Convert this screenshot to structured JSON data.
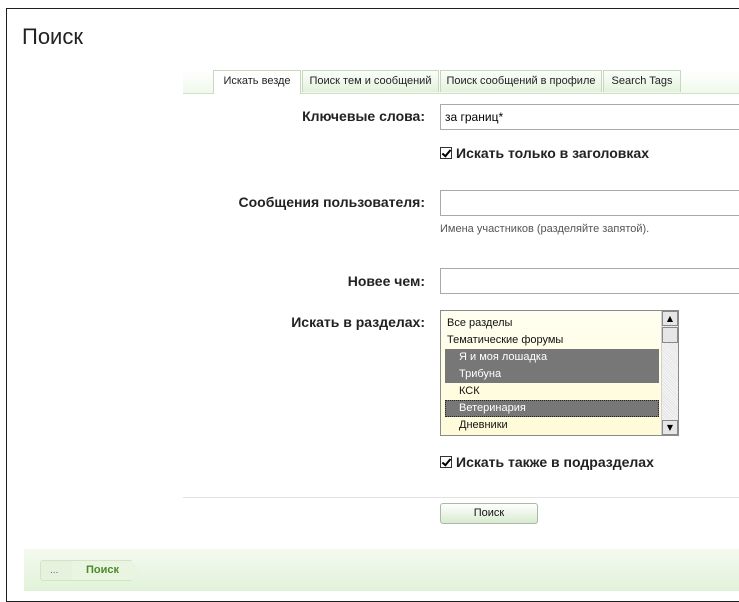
{
  "page": {
    "title": "Поиск"
  },
  "tabs": [
    {
      "label": "Искать везде",
      "active": true
    },
    {
      "label": "Поиск тем и сообщений",
      "active": false
    },
    {
      "label": "Поиск сообщений в профиле",
      "active": false
    },
    {
      "label": "Search Tags",
      "active": false
    }
  ],
  "form": {
    "keywords_label": "Ключевые слова:",
    "keywords_value": "за границ*",
    "titles_only_label": "Искать только в заголовках",
    "titles_only_checked": true,
    "user_posts_label": "Сообщения пользователя:",
    "user_posts_value": "",
    "user_posts_hint": "Имена участников (разделяйте запятой).",
    "newer_than_label": "Новее чем:",
    "newer_than_value": "",
    "sections_label": "Искать в разделах:",
    "sections_options": [
      {
        "label": "Все разделы",
        "selected": false
      },
      {
        "label": "Тематические форумы",
        "selected": false
      },
      {
        "label": "Я и моя лошадка",
        "selected": true
      },
      {
        "label": "Трибуна",
        "selected": true
      },
      {
        "label": "КСК",
        "selected": false
      },
      {
        "label": "Ветеринария",
        "selected": true
      },
      {
        "label": "Дневники",
        "selected": false
      }
    ],
    "subsections_label": "Искать также в подразделах",
    "subsections_checked": true,
    "submit_label": "Поиск"
  },
  "breadcrumb": {
    "home": "...",
    "current": "Поиск"
  }
}
